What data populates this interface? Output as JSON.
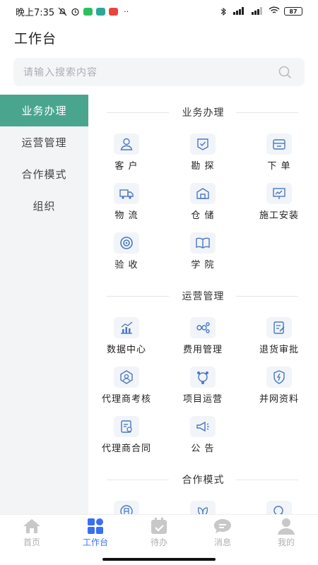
{
  "status_bar": {
    "time": "晚上7:35",
    "battery": "87"
  },
  "header": {
    "title": "工作台"
  },
  "search": {
    "placeholder": "请输入搜索内容"
  },
  "sidebar": {
    "items": [
      {
        "label": "业务办理",
        "active": true
      },
      {
        "label": "运营管理",
        "active": false
      },
      {
        "label": "合作模式",
        "active": false
      },
      {
        "label": "组织",
        "active": false
      }
    ]
  },
  "sections": [
    {
      "title": "业务办理",
      "items": [
        {
          "label": "客 户",
          "icon": "customer-icon"
        },
        {
          "label": "勘 探",
          "icon": "survey-icon"
        },
        {
          "label": "下 单",
          "icon": "order-icon"
        },
        {
          "label": "物 流",
          "icon": "truck-icon"
        },
        {
          "label": "仓 储",
          "icon": "warehouse-icon"
        },
        {
          "label": "施工安装",
          "icon": "install-icon"
        },
        {
          "label": "验 收",
          "icon": "acceptance-icon"
        },
        {
          "label": "学 院",
          "icon": "book-icon"
        }
      ]
    },
    {
      "title": "运营管理",
      "items": [
        {
          "label": "数据中心",
          "icon": "chart-icon"
        },
        {
          "label": "费用管理",
          "icon": "cost-icon"
        },
        {
          "label": "退货审批",
          "icon": "return-approve-icon"
        },
        {
          "label": "代理商考核",
          "icon": "agent-assess-icon"
        },
        {
          "label": "项目运营",
          "icon": "project-icon"
        },
        {
          "label": "并网资料",
          "icon": "grid-doc-icon"
        },
        {
          "label": "代理商合同",
          "icon": "contract-icon"
        },
        {
          "label": "公 告",
          "icon": "megaphone-icon"
        }
      ]
    },
    {
      "title": "合作模式",
      "items": [
        {
          "label": "",
          "icon": "rent-icon"
        },
        {
          "label": "",
          "icon": "leaf-icon"
        },
        {
          "label": "",
          "icon": "person-search-icon"
        }
      ]
    }
  ],
  "bottom_nav": {
    "items": [
      {
        "label": "首页",
        "icon": "home-icon",
        "active": false
      },
      {
        "label": "工作台",
        "icon": "workbench-icon",
        "active": true
      },
      {
        "label": "待办",
        "icon": "todo-icon",
        "active": false
      },
      {
        "label": "消息",
        "icon": "message-icon",
        "active": false
      },
      {
        "label": "我的",
        "icon": "profile-icon",
        "active": false
      }
    ]
  },
  "colors": {
    "accent": "#4aa58f",
    "nav_active": "#3a6ff2",
    "icon_stroke": "#4a78c2"
  }
}
